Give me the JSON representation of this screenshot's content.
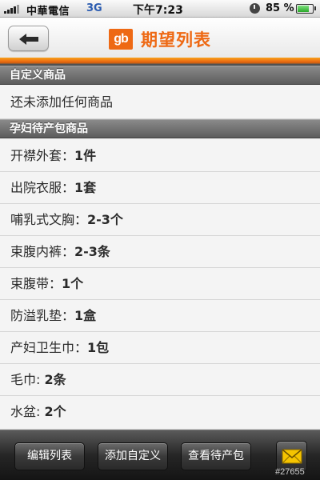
{
  "status_bar": {
    "carrier": "中華電信",
    "network": "3G",
    "time": "下午7:23",
    "battery_percent": "85 %",
    "battery_level": 0.85
  },
  "nav": {
    "logo_text": "gb",
    "title": "期望列表"
  },
  "sections": [
    {
      "header": "自定义商品",
      "items": [
        {
          "name": "还未添加任何商品",
          "qty": ""
        }
      ]
    },
    {
      "header": "孕妇待产包商品",
      "items": [
        {
          "name": "开襟外套：",
          "qty": "1件"
        },
        {
          "name": "出院衣服：",
          "qty": "1套"
        },
        {
          "name": "哺乳式文胸：",
          "qty": "2-3个"
        },
        {
          "name": "束腹内裤：",
          "qty": "2-3条"
        },
        {
          "name": "束腹带：",
          "qty": "1个"
        },
        {
          "name": "防溢乳垫：",
          "qty": "1盒"
        },
        {
          "name": "产妇卫生巾：",
          "qty": "1包"
        },
        {
          "name": "毛巾: ",
          "qty": "2条"
        },
        {
          "name": "水盆: ",
          "qty": "2个"
        }
      ]
    }
  ],
  "toolbar": {
    "edit_label": "编辑列表",
    "add_label": "添加自定义",
    "view_label": "查看待产包"
  },
  "watermark": "#27655",
  "colors": {
    "accent": "#ee6914",
    "header_bg": "#6e6e6e",
    "toolbar_bg": "#262626"
  }
}
